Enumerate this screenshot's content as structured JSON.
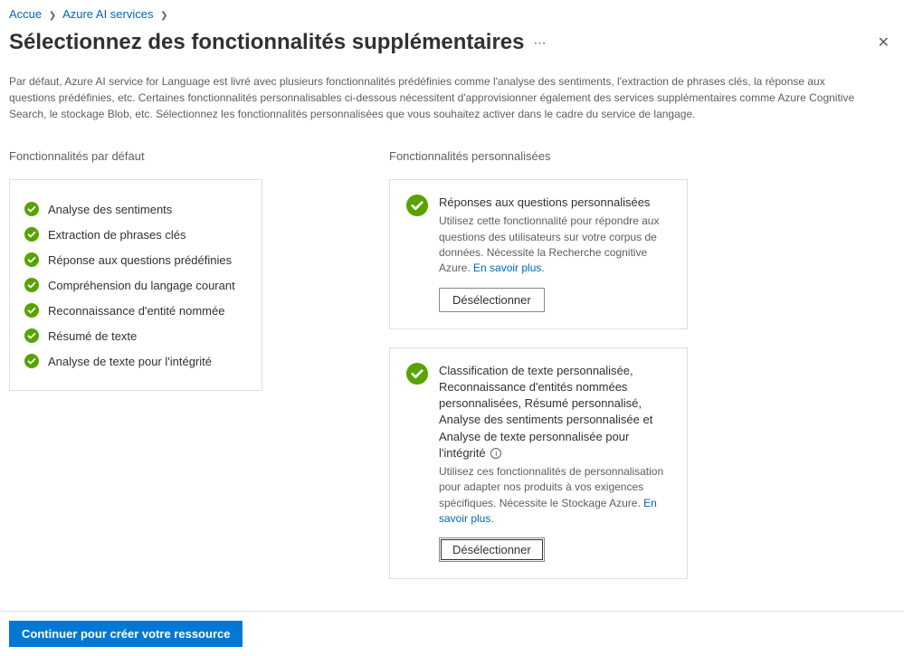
{
  "breadcrumb": {
    "item1": "Accue",
    "item2": "Azure AI services"
  },
  "header": {
    "title": "Sélectionnez des fonctionnalités supplémentaires"
  },
  "description": "Par défaut, Azure AI service for Language est livré avec plusieurs fonctionnalités prédéfinies comme l'analyse des sentiments, l'extraction de phrases clés, la réponse aux questions prédéfinies, etc. Certaines fonctionnalités personnalisables ci-dessous nécessitent d'approvisionner également des services supplémentaires comme Azure Cognitive Search, le stockage Blob, etc. Sélectionnez les fonctionnalités personnalisées que vous souhaitez activer dans le cadre du service de langage.",
  "defaultSection": {
    "heading": "Fonctionnalités par défaut",
    "items": [
      "Analyse des sentiments",
      "Extraction de phrases clés",
      "Réponse aux questions prédéfinies",
      "Compréhension du langage courant",
      "Reconnaissance d'entité nommée",
      "Résumé de texte",
      "Analyse de texte pour l'intégrité"
    ]
  },
  "customSection": {
    "heading": "Fonctionnalités personnalisées",
    "card1": {
      "title": "Réponses aux questions personnalisées",
      "desc": "Utilisez cette fonctionnalité pour répondre aux questions des utilisateurs sur votre corpus de données. Nécessite la Recherche cognitive Azure. ",
      "link": "En savoir plus.",
      "button": "Désélectionner"
    },
    "card2": {
      "title": "Classification de texte personnalisée, Reconnaissance d'entités nommées personnalisées, Résumé personnalisé, Analyse des sentiments personnalisée et Analyse de texte personnalisée pour l'intégrité",
      "desc": "Utilisez ces fonctionnalités de personnalisation pour adapter nos produits à vos exigences spécifiques. Nécessite le Stockage Azure. ",
      "link": "En savoir plus.",
      "button": "Désélectionner"
    }
  },
  "footer": {
    "continueButton": "Continuer pour créer votre ressource"
  }
}
